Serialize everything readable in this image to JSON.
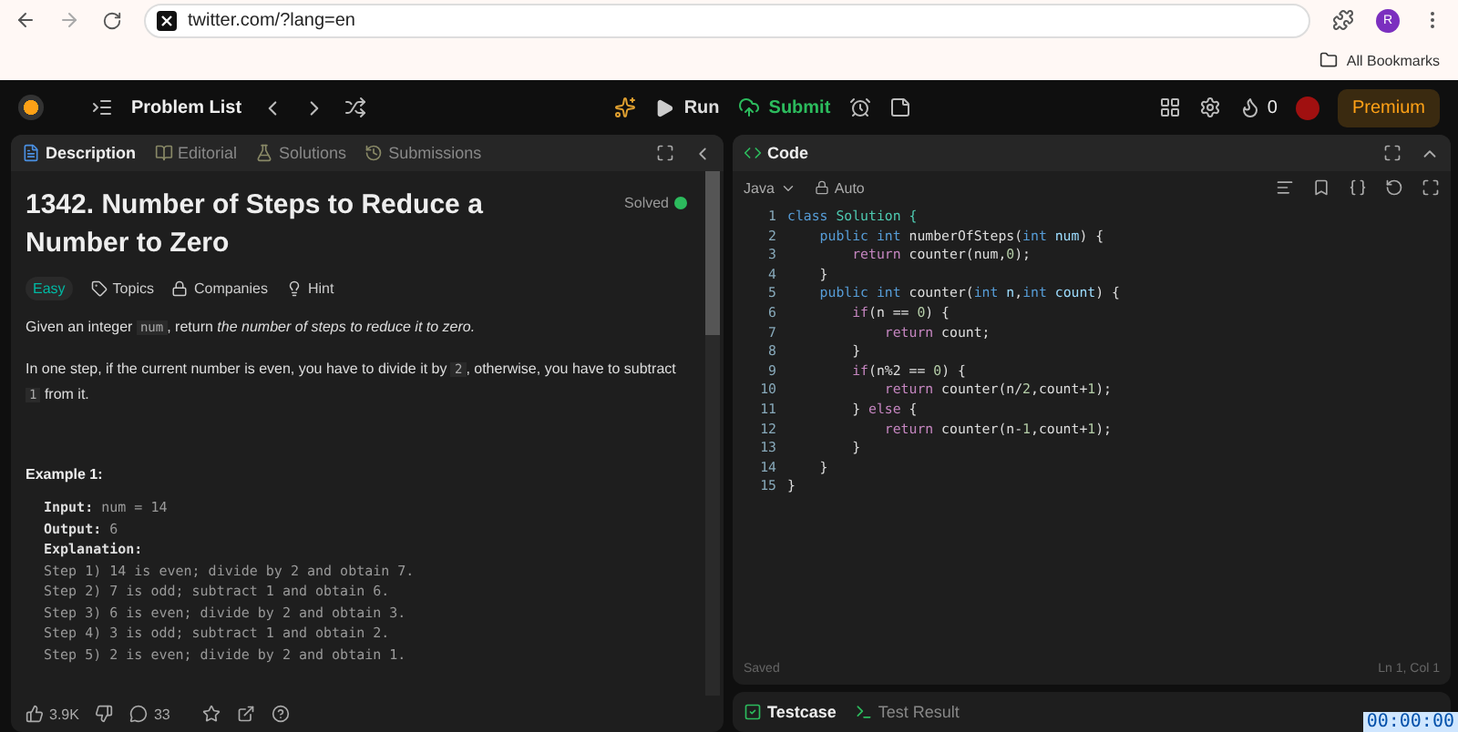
{
  "browser": {
    "url": "twitter.com/?lang=en",
    "avatar": "R",
    "bookmarks": "All Bookmarks"
  },
  "header": {
    "problem_list": "Problem List",
    "run": "Run",
    "submit": "Submit",
    "streak": "0",
    "premium": "Premium"
  },
  "left_tabs": [
    {
      "label": "Description",
      "selected": true
    },
    {
      "label": "Editorial",
      "selected": false
    },
    {
      "label": "Solutions",
      "selected": false
    },
    {
      "label": "Submissions",
      "selected": false
    }
  ],
  "problem": {
    "title": "1342. Number of Steps to Reduce a Number to Zero",
    "status": "Solved",
    "difficulty": "Easy",
    "tags": [
      "Topics",
      "Companies",
      "Hint"
    ],
    "paragraphs": [
      [
        {
          "kind": "text",
          "text": "Given an integer "
        },
        {
          "kind": "code",
          "text": "num"
        },
        {
          "kind": "text",
          "text": ", return "
        },
        {
          "kind": "italic",
          "text": "the number of steps to reduce it to zero."
        }
      ],
      [
        {
          "kind": "text",
          "text": "In one step, if the current number is even, you have to divide it by "
        },
        {
          "kind": "code",
          "text": "2"
        },
        {
          "kind": "text",
          "text": ", otherwise, you have to subtract "
        },
        {
          "kind": "code",
          "text": "1"
        },
        {
          "kind": "text",
          "text": " from it."
        }
      ]
    ],
    "example_title": "Example 1:",
    "example_lines": [
      "**Input:** num = 14",
      "**Output:** 6",
      "**Explanation:**",
      "Step 1) 14 is even; divide by 2 and obtain 7.",
      "Step 2) 7 is odd; subtract 1 and obtain 6.",
      "Step 3) 6 is even; divide by 2 and obtain 3.",
      "Step 4) 3 is odd; subtract 1 and obtain 2.",
      "Step 5) 2 is even; divide by 2 and obtain 1."
    ]
  },
  "footer": {
    "likes": "3.9K",
    "comments": "33"
  },
  "code_panel": {
    "title": "Code",
    "language": "Java",
    "mode": "Auto",
    "status": "Saved",
    "cursor": "Ln 1, Col 1",
    "lines": [
      {
        "number": "1",
        "tokens": [
          {
            "kind": "kw",
            "text": "class"
          },
          {
            "kind": "type",
            "text": " Solution {"
          }
        ]
      },
      {
        "number": "2",
        "tokens": [
          {
            "kind": "kw",
            "text": "    public int"
          },
          {
            "kind": "plain",
            "text": " numberOfSteps("
          },
          {
            "kind": "kw",
            "text": "int"
          },
          {
            "kind": "var",
            "text": " num"
          },
          {
            "kind": "plain",
            "text": ") {"
          }
        ]
      },
      {
        "number": "3",
        "tokens": [
          {
            "kind": "ctrl",
            "text": "        return"
          },
          {
            "kind": "plain",
            "text": " counter(num,"
          },
          {
            "kind": "num",
            "text": "0"
          },
          {
            "kind": "plain",
            "text": ");"
          }
        ]
      },
      {
        "number": "4",
        "tokens": [
          {
            "kind": "plain",
            "text": "    }"
          }
        ]
      },
      {
        "number": "5",
        "tokens": [
          {
            "kind": "kw",
            "text": "    public int"
          },
          {
            "kind": "plain",
            "text": " counter("
          },
          {
            "kind": "kw",
            "text": "int"
          },
          {
            "kind": "var",
            "text": " n"
          },
          {
            "kind": "plain",
            "text": ","
          },
          {
            "kind": "kw",
            "text": "int"
          },
          {
            "kind": "var",
            "text": " count"
          },
          {
            "kind": "plain",
            "text": ") {"
          }
        ]
      },
      {
        "number": "6",
        "tokens": [
          {
            "kind": "ctrl",
            "text": "        if"
          },
          {
            "kind": "plain",
            "text": "(n == "
          },
          {
            "kind": "num",
            "text": "0"
          },
          {
            "kind": "plain",
            "text": ") {"
          }
        ]
      },
      {
        "number": "7",
        "tokens": [
          {
            "kind": "ctrl",
            "text": "            return"
          },
          {
            "kind": "plain",
            "text": " count;"
          }
        ]
      },
      {
        "number": "8",
        "tokens": [
          {
            "kind": "plain",
            "text": "        }"
          }
        ]
      },
      {
        "number": "9",
        "tokens": [
          {
            "kind": "ctrl",
            "text": "        if"
          },
          {
            "kind": "plain",
            "text": "(n%2 == "
          },
          {
            "kind": "num",
            "text": "0"
          },
          {
            "kind": "plain",
            "text": ") {"
          }
        ]
      },
      {
        "number": "10",
        "tokens": [
          {
            "kind": "ctrl",
            "text": "            return"
          },
          {
            "kind": "plain",
            "text": " counter(n/"
          },
          {
            "kind": "num",
            "text": "2"
          },
          {
            "kind": "plain",
            "text": ",count+"
          },
          {
            "kind": "num",
            "text": "1"
          },
          {
            "kind": "plain",
            "text": ");"
          }
        ]
      },
      {
        "number": "11",
        "tokens": [
          {
            "kind": "plain",
            "text": "        } "
          },
          {
            "kind": "ctrl",
            "text": "else"
          },
          {
            "kind": "plain",
            "text": " {"
          }
        ]
      },
      {
        "number": "12",
        "tokens": [
          {
            "kind": "ctrl",
            "text": "            return"
          },
          {
            "kind": "plain",
            "text": " counter(n-"
          },
          {
            "kind": "num",
            "text": "1"
          },
          {
            "kind": "plain",
            "text": ",count+"
          },
          {
            "kind": "num",
            "text": "1"
          },
          {
            "kind": "plain",
            "text": ");"
          }
        ]
      },
      {
        "number": "13",
        "tokens": [
          {
            "kind": "plain",
            "text": "        }"
          }
        ]
      },
      {
        "number": "14",
        "tokens": [
          {
            "kind": "plain",
            "text": "    }"
          }
        ]
      },
      {
        "number": "15",
        "tokens": [
          {
            "kind": "plain",
            "text": "}"
          }
        ]
      }
    ]
  },
  "bottom_tabs": [
    {
      "label": "Testcase",
      "selected": true
    },
    {
      "label": "Test Result",
      "selected": false
    }
  ],
  "timer": "00:00:00"
}
